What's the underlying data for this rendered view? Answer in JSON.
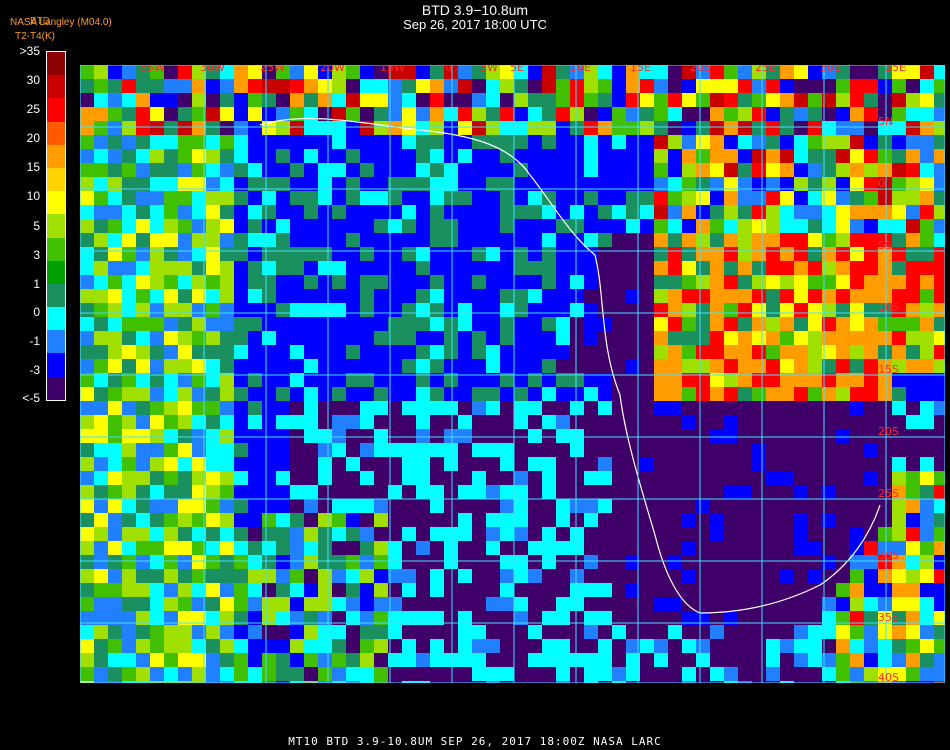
{
  "header": {
    "title": "BTD 3.9−10.8um",
    "subtitle": "Sep 26, 2017 18:00 UTC",
    "credit": "NASA Langley (M04.0)",
    "legend_title_1": "BTD",
    "legend_title_2": "T2-T4(K)"
  },
  "colorbar": {
    "ticks": [
      ">35",
      "30",
      "25",
      "20",
      "15",
      "10",
      "5",
      "3",
      "1",
      "0",
      "-1",
      "-3",
      "<-5"
    ],
    "colors": [
      "#8b0000",
      "#c80000",
      "#ff0000",
      "#ff5a00",
      "#ff9c00",
      "#ffd200",
      "#ffff00",
      "#a0e000",
      "#40c000",
      "#00a000",
      "#1a9060",
      "#00ffff",
      "#2080ff",
      "#0000ff",
      "#40006a"
    ]
  },
  "map": {
    "lon_labels": [
      "35W",
      "30W",
      "25W",
      "20W",
      "15W",
      "5W",
      "0",
      "5E",
      "10E",
      "15E",
      "20E",
      "25E",
      "30E",
      "35E"
    ],
    "lat_labels": [
      "5N",
      "0",
      "5S",
      "10S",
      "15S",
      "20S",
      "25S",
      "30S",
      "35S",
      "40S"
    ],
    "grid_color": "#44e0ff",
    "coast_color": "#ffffff"
  },
  "footer": {
    "text": "MT10  BTD 3.9-10.8UM   SEP 26, 2017 18:00Z   NASA LARC"
  }
}
